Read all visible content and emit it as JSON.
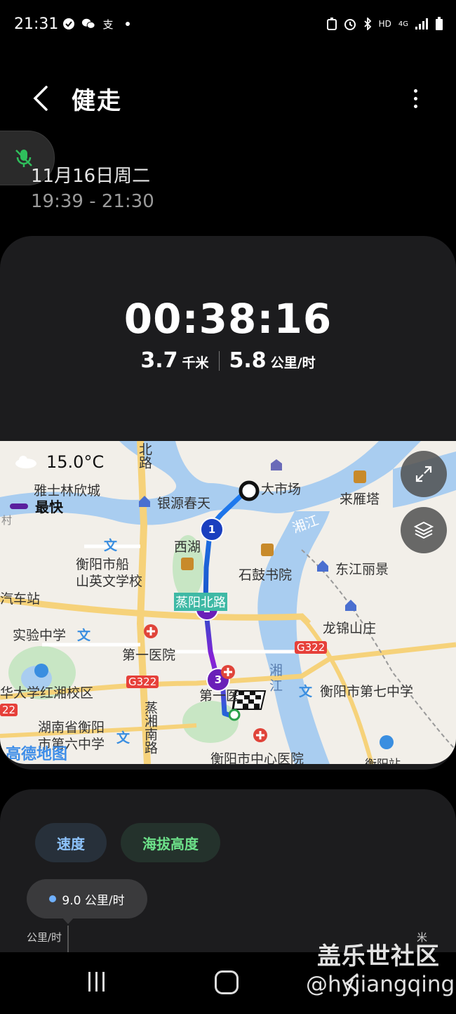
{
  "status_bar": {
    "time": "21:31",
    "network_label": "HD",
    "signal_label": "4G"
  },
  "header": {
    "title": "健走"
  },
  "session": {
    "date": "11月16日周二",
    "time_range": "19:39 - 21:30"
  },
  "summary": {
    "duration": "00:38:16",
    "distance_value": "3.7",
    "distance_unit": "千米",
    "speed_value": "5.8",
    "speed_unit": "公里/时"
  },
  "map": {
    "temperature": "15.0°C",
    "legend_label": "最快",
    "route_markers": [
      "1",
      "2",
      "3"
    ],
    "labels": {
      "bei_lu": "北路",
      "yashilin": "雅士林欣城",
      "yinyuan": "银源春天",
      "dashichang": "大市场",
      "laiyanta": "来雁塔",
      "xiangjiang_1": "湘江",
      "xihu": "西湖",
      "cun": "村",
      "hengyang_ship": "衡阳市船\n山英文学校",
      "shigu": "石鼓书院",
      "dongjiang": "东江丽景",
      "qichezhan": "汽车站",
      "yanyang_road": "蒸阳北路",
      "longjin": "龙锦山庄",
      "shiyan": "实验中学",
      "diyi_yiyuan": "第一医院",
      "g322_a": "G322",
      "g322_b": "G322",
      "g322_c": "22",
      "huada": "华大学红湘校区",
      "xiangjiang_2": "湘\n江",
      "diqi_zhongxue": "衡阳市第七中学",
      "hunan_heng": "湖南省衡阳\n市第六中学",
      "zhengxiang": "蒸湘南路",
      "diyi_short": "第一医",
      "zhongxin": "衡阳市中心医院",
      "gaode": "高德地图",
      "hengyang_station": "衡阳站"
    }
  },
  "chart_section": {
    "tab_speed": "速度",
    "tab_altitude": "海拔高度",
    "tooltip": "9.0 公里/时",
    "axis_unit_left": "公里/时",
    "axis_unit_right": "米"
  },
  "watermark": {
    "line1": "盖乐世社区",
    "line2": "@hyjiangqing"
  }
}
